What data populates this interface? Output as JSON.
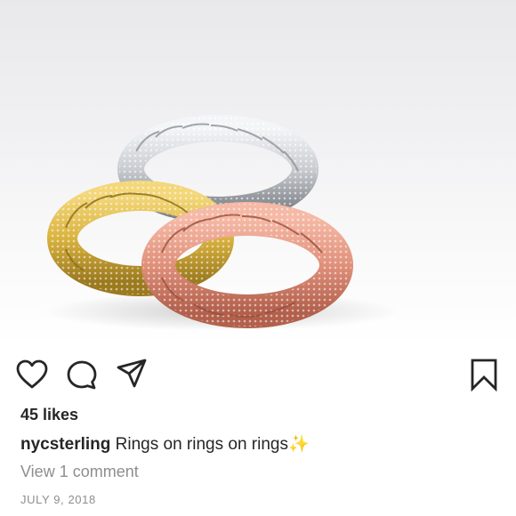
{
  "post": {
    "image_subject": "gold, silver and rose gold cuban link rings",
    "colors": {
      "gold": "#d9b33f",
      "silver": "#cfd2d6",
      "rose_gold": "#e0907a"
    }
  },
  "actions": {
    "like_icon": "heart-icon",
    "comment_icon": "comment-icon",
    "share_icon": "paper-plane-icon",
    "save_icon": "bookmark-icon"
  },
  "likes_text": "45 likes",
  "caption": {
    "username": "nycsterling",
    "text": "Rings on rings on rings",
    "emoji": "✨"
  },
  "view_comments_text": "View 1 comment",
  "date_text": "JULY 9, 2018"
}
